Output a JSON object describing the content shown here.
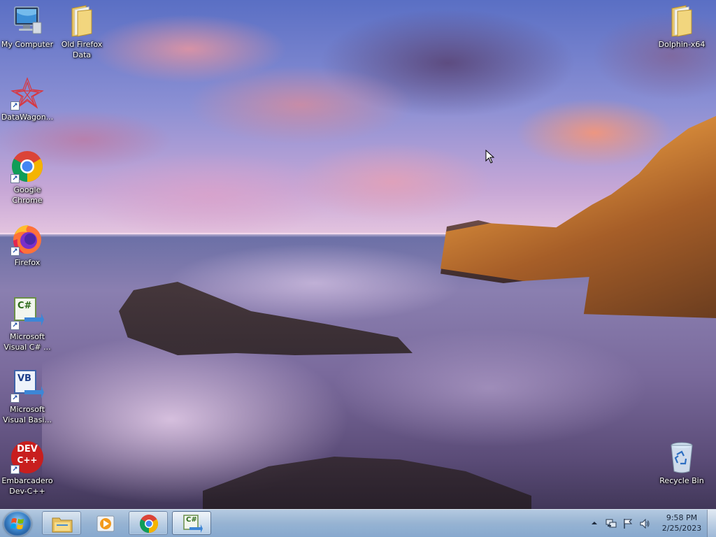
{
  "desktop": {
    "icons": [
      {
        "label": "My Computer",
        "icon": "computer-icon"
      },
      {
        "label": "Old Firefox\nData",
        "icon": "folder-icon"
      },
      {
        "label": "DataWagon...",
        "icon": "datawagon-icon"
      },
      {
        "label": "Google\nChrome",
        "icon": "chrome-icon"
      },
      {
        "label": "Firefox",
        "icon": "firefox-icon"
      },
      {
        "label": "Microsoft\nVisual C# ...",
        "icon": "visual-csharp-icon"
      },
      {
        "label": "Microsoft\nVisual Basi...",
        "icon": "visual-basic-icon"
      },
      {
        "label": "Embarcadero\nDev-C++",
        "icon": "devcpp-icon"
      },
      {
        "label": "Dolphin-x64",
        "icon": "folder-icon"
      },
      {
        "label": "Recycle Bin",
        "icon": "recycle-bin-icon"
      }
    ],
    "csharp_badge": "C#",
    "vb_badge": "VB",
    "dev_badge_top": "DEV",
    "dev_badge_bottom": "C++"
  },
  "taskbar": {
    "start_icon": "windows-start-icon",
    "pinned": [
      {
        "name": "file-explorer",
        "icon": "folder-icon"
      },
      {
        "name": "media-player",
        "icon": "media-player-icon"
      },
      {
        "name": "google-chrome",
        "icon": "chrome-icon"
      },
      {
        "name": "visual-csharp",
        "icon": "visual-csharp-icon",
        "badge": "C#"
      }
    ],
    "tray_icons": [
      "show-hidden-icons-chevron-icon",
      "network-icon",
      "action-center-flag-icon",
      "volume-icon"
    ],
    "clock": {
      "time": "9:58 PM",
      "date": "2/25/2023"
    }
  },
  "colors": {
    "taskbar": "#9ebede",
    "start_orb": "#3b83c8",
    "chrome_red": "#db4437",
    "chrome_yellow": "#f4b400",
    "chrome_green": "#0f9d58",
    "chrome_blue": "#4285f4",
    "devcpp_red": "#c81e1e"
  }
}
